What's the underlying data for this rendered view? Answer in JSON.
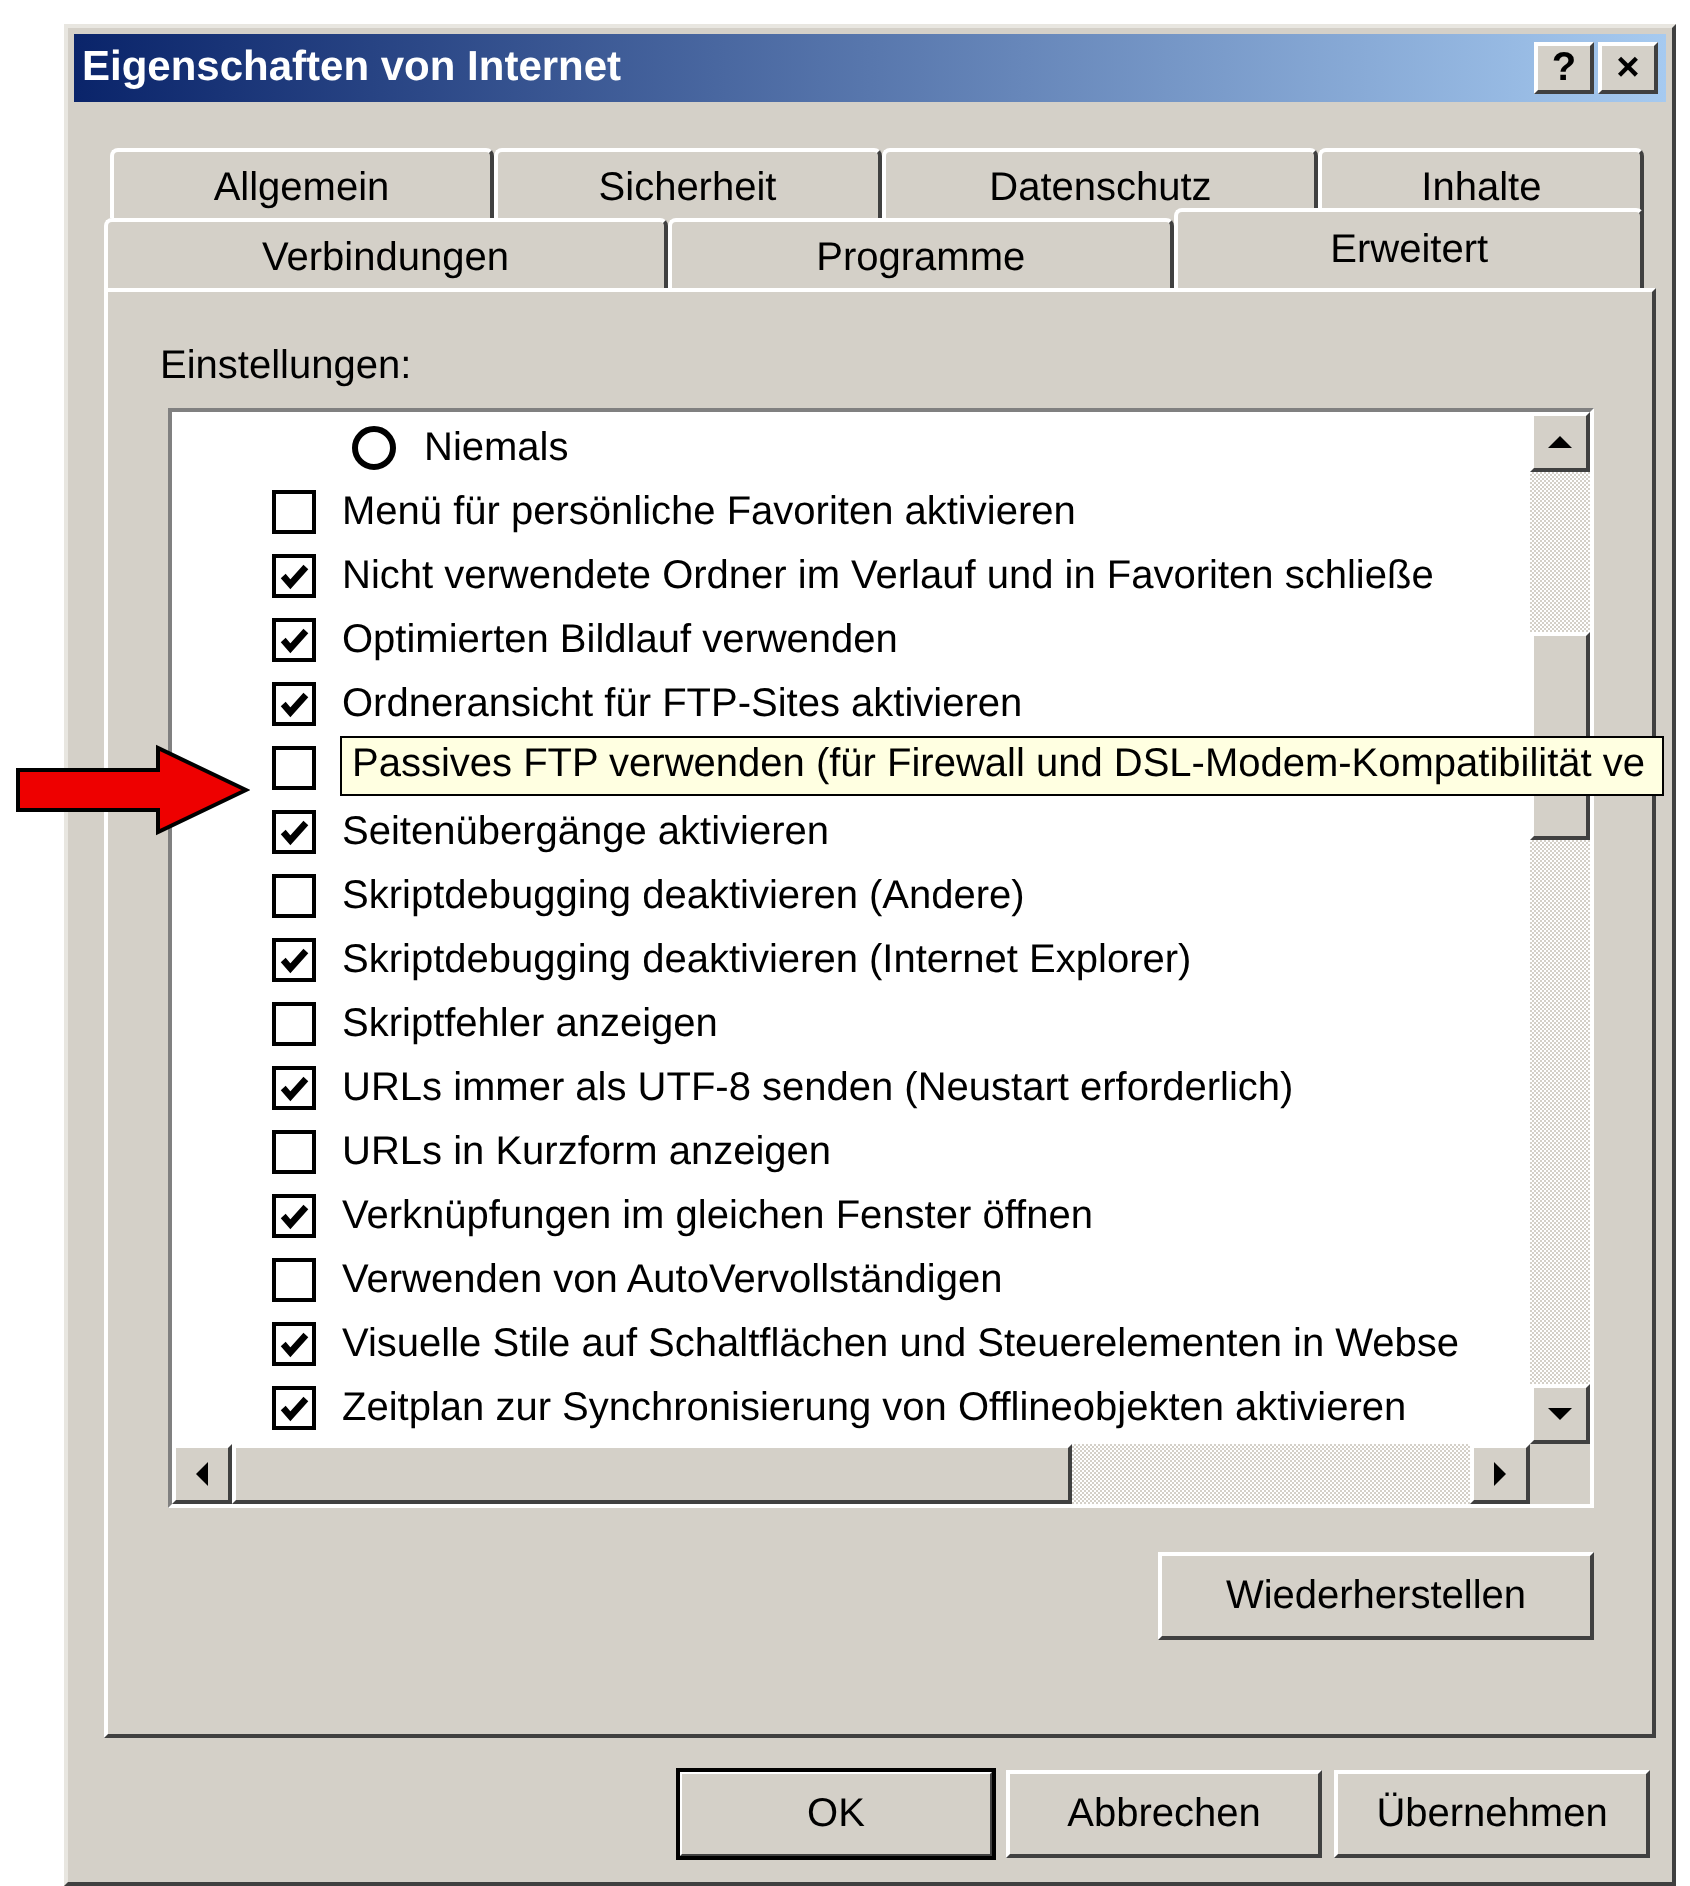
{
  "window": {
    "title": "Eigenschaften von Internet",
    "title_buttons": [
      "?",
      "×"
    ]
  },
  "tab_rows": [
    [
      {
        "label": "Allgemein",
        "selected": false
      },
      {
        "label": "Sicherheit",
        "selected": false
      },
      {
        "label": "Datenschutz",
        "selected": false
      },
      {
        "label": "Inhalte",
        "selected": false
      }
    ],
    [
      {
        "label": "Verbindungen",
        "selected": false
      },
      {
        "label": "Programme",
        "selected": false
      },
      {
        "label": "Erweitert",
        "selected": true
      }
    ]
  ],
  "settings_label": "Einstellungen:",
  "settings": [
    {
      "kind": "radio",
      "label": "Niemals",
      "checked": false
    },
    {
      "kind": "checkbox",
      "label": "Menü für persönliche Favoriten aktivieren",
      "checked": false
    },
    {
      "kind": "checkbox",
      "label": "Nicht verwendete Ordner im Verlauf und in Favoriten schließe",
      "checked": true
    },
    {
      "kind": "checkbox",
      "label": "Optimierten Bildlauf verwenden",
      "checked": true
    },
    {
      "kind": "checkbox",
      "label": "Ordneransicht für FTP-Sites aktivieren",
      "checked": true
    },
    {
      "kind": "checkbox",
      "label": "Passives FTP verwenden (für Firewall und DSL-Modem-Kompatibilität ve",
      "checked": false,
      "tooltip": true
    },
    {
      "kind": "checkbox",
      "label": "Seitenübergänge aktivieren",
      "checked": true
    },
    {
      "kind": "checkbox",
      "label": "Skriptdebugging deaktivieren (Andere)",
      "checked": false
    },
    {
      "kind": "checkbox",
      "label": "Skriptdebugging deaktivieren (Internet Explorer)",
      "checked": true
    },
    {
      "kind": "checkbox",
      "label": "Skriptfehler anzeigen",
      "checked": false
    },
    {
      "kind": "checkbox",
      "label": "URLs immer als UTF-8 senden (Neustart erforderlich)",
      "checked": true
    },
    {
      "kind": "checkbox",
      "label": "URLs in Kurzform anzeigen",
      "checked": false
    },
    {
      "kind": "checkbox",
      "label": "Verknüpfungen im gleichen Fenster öffnen",
      "checked": true
    },
    {
      "kind": "checkbox",
      "label": "Verwenden von AutoVervollständigen",
      "checked": false
    },
    {
      "kind": "checkbox",
      "label": "Visuelle Stile auf Schaltflächen und Steuerelementen in Webse",
      "checked": true
    },
    {
      "kind": "checkbox",
      "label": "Zeitplan zur Synchronisierung von Offlineobjekten aktivieren",
      "checked": true
    }
  ],
  "restore_button": "Wiederherstellen",
  "buttons": [
    {
      "label": "OK",
      "default": true
    },
    {
      "label": "Abbrechen",
      "default": false
    },
    {
      "label": "Übernehmen",
      "default": false
    }
  ]
}
